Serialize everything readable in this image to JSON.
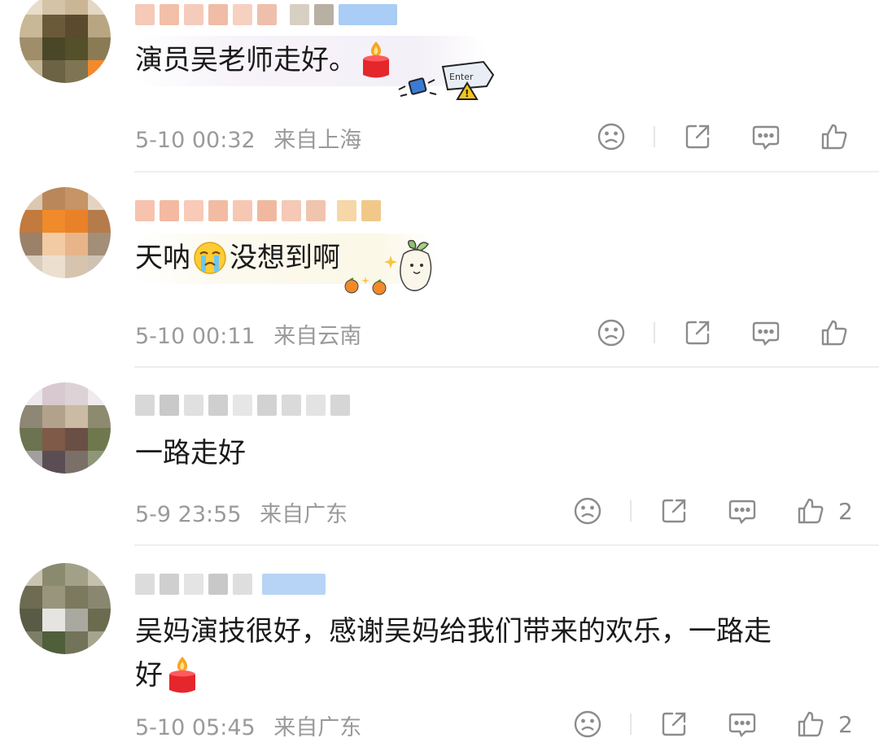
{
  "comments": [
    {
      "text": "演员吴老师走好。",
      "time": "5-10 00:32",
      "location": "来自上海",
      "likes": "",
      "text_line2": ""
    },
    {
      "text_a": "天呐",
      "text_b": "没想到啊",
      "time": "5-10 00:11",
      "location": "来自云南",
      "likes": ""
    },
    {
      "text": "一路走好",
      "time": "5-9 23:55",
      "location": "来自广东",
      "likes": "2"
    },
    {
      "text": "吴妈演技很好，感谢吴妈给我们带来的欢乐，一路走",
      "text_line2": "好",
      "time": "5-10 05:45",
      "location": "来自广东",
      "likes": "2"
    }
  ],
  "colors": {
    "text": "#1a1a1a",
    "meta": "#9a9a9a",
    "icon": "#8c8c8c",
    "divider": "#eeeeee",
    "candle_red": "#e5262b",
    "flame": "#f5a623"
  },
  "icons": {
    "dislike": "frown-face-icon",
    "share": "share-icon",
    "comment": "comment-bubble-icon",
    "like": "thumbs-up-icon",
    "candle": "candle-emoji",
    "cry": "crying-face-emoji",
    "sticker_enter": "enter-key-sticker",
    "sticker_radish": "radish-sticker"
  }
}
